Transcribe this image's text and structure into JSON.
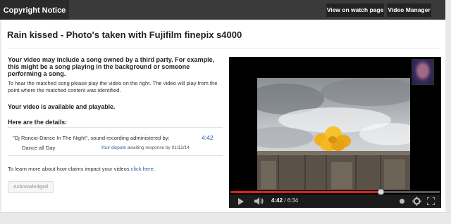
{
  "topbar": {
    "tab_label": "Copyright Notice",
    "watch_button": "View on watch page",
    "manager_button": "Video Manager"
  },
  "main": {
    "title": "Rain kissed - Photo's taken with Fujifilm finepix s4000",
    "warning": "Your video may include a song owned by a third party. For example, this might be a song playing in the background or someone performing a song.",
    "hear_text": "To hear the matched song please play the video on the right. The video will play from the point where the matched content was identified.",
    "available": "Your video is available and playable.",
    "details_heading": "Here are the details:",
    "claim": {
      "song_line": "\"Dj Roncio-Dance In The Night\", sound recording administered by:",
      "time": "4:42",
      "song_title": "Dance all Day",
      "dispute_link": "Your dispute",
      "dispute_status": "awaiting response by 01/12/14"
    },
    "learn_text": "To learn more about how claims impact your videos ",
    "learn_link": "click here.",
    "ack_button": "Acknowledged"
  },
  "player": {
    "time_current": "4:42",
    "time_total": "6:34",
    "progress": 0.717,
    "accent": "#e01e1e",
    "icons": [
      "play-icon",
      "volume-icon",
      "captions-icon",
      "settings-icon",
      "fullscreen-icon"
    ]
  }
}
